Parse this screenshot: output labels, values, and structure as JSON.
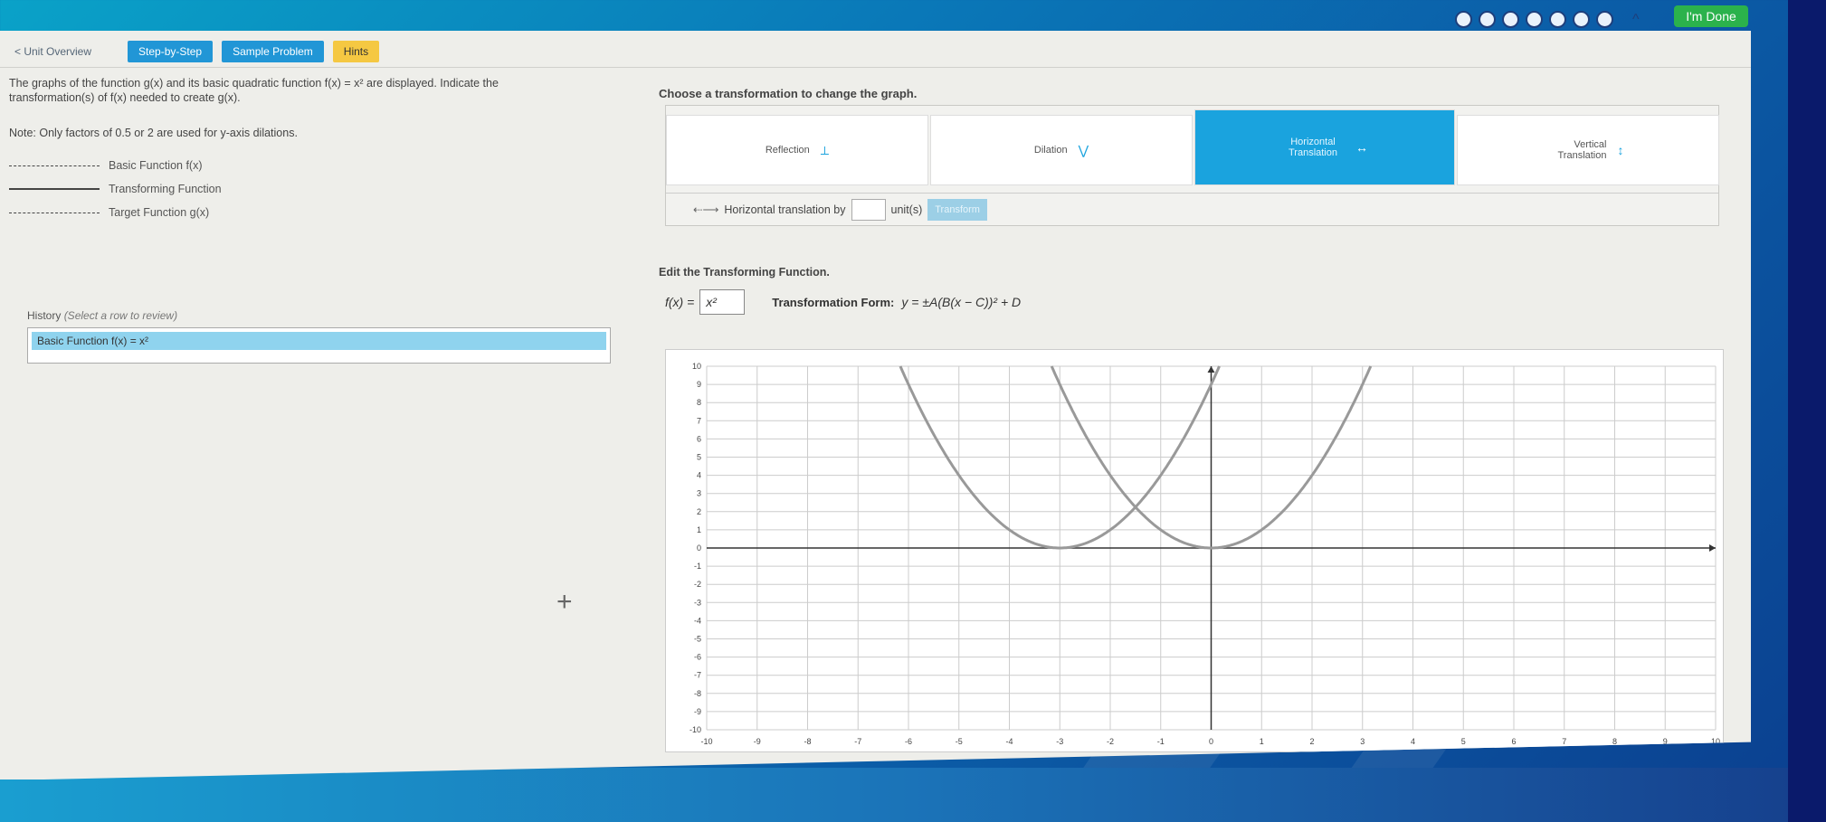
{
  "progress": {
    "steps": 7
  },
  "done_label": "I'm Done",
  "nav": {
    "unit_overview": "< Unit Overview",
    "tabs": [
      {
        "label": "Step-by-Step",
        "color": "#2196d6"
      },
      {
        "label": "Sample Problem",
        "color": "#2196d6"
      },
      {
        "label": "Hints",
        "color": "#f5c842"
      }
    ]
  },
  "question": {
    "line1": "The graphs of the function g(x) and its basic quadratic function f(x) = x² are displayed. Indicate the",
    "line2": "transformation(s) of f(x) needed to create g(x).",
    "note_label": "Note:",
    "note_text": "Only factors of 0.5 or 2 are used for y-axis dilations."
  },
  "legend": [
    {
      "label": "Basic Function f(x)",
      "style": "dashed"
    },
    {
      "label": "Transforming Function",
      "style": "solid"
    },
    {
      "label": "Target Function g(x)",
      "style": "dashed"
    }
  ],
  "history": {
    "title": "History",
    "subtitle": "(Select a row to review)",
    "rows": [
      "Basic Function f(x) = x²"
    ]
  },
  "transform": {
    "title": "Choose a transformation to change the graph.",
    "options": [
      {
        "label": "Reflection",
        "icon": "reflection-icon",
        "active": false
      },
      {
        "label": "Dilation",
        "icon": "dilation-icon",
        "active": false
      },
      {
        "label": "Horizontal Translation",
        "icon": "horizontal-arrows-icon",
        "active": true
      },
      {
        "label": "Vertical Translation",
        "icon": "vertical-arrows-icon",
        "active": false
      }
    ],
    "row_text": "Horizontal translation by",
    "unit_text": "unit(s)",
    "button_label": "Transform"
  },
  "edit": {
    "title": "Edit the Transforming Function.",
    "func_prefix": "f(x) =",
    "func_value": "x²",
    "form_label": "Transformation Form:",
    "form_eq": "y = ±A(B(x − C))² + D"
  },
  "chart_data": {
    "type": "line",
    "xlim": [
      -10,
      10
    ],
    "ylim": [
      -10,
      10
    ],
    "xticks": [
      -10,
      -9,
      -8,
      -7,
      -6,
      -5,
      -4,
      -3,
      -2,
      -1,
      0,
      1,
      2,
      3,
      4,
      5,
      6,
      7,
      8,
      9,
      10
    ],
    "yticks": [
      -10,
      -9,
      -8,
      -7,
      -6,
      -5,
      -4,
      -3,
      -2,
      -1,
      0,
      1,
      2,
      3,
      4,
      5,
      6,
      7,
      8,
      9,
      10
    ],
    "grid": true,
    "series": [
      {
        "formula": "x^2",
        "vertex": [
          0,
          0
        ]
      },
      {
        "formula": "(x+3)^2",
        "vertex": [
          -3,
          0
        ]
      }
    ]
  }
}
